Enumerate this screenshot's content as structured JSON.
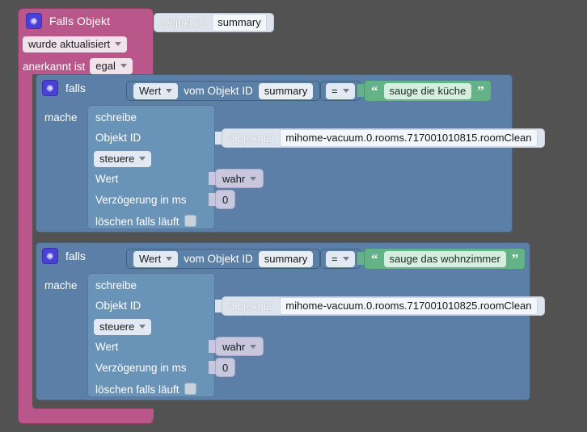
{
  "app": {
    "title": "Blockly script editor",
    "canvas_background": "#525252"
  },
  "colors": {
    "trigger_block": "#b9568a",
    "control_block": "#5b7fa6",
    "statement_block": "#6a93b8",
    "value_block": "#5b80a8",
    "string_block": "#64b287",
    "argument_block": "#dde4ed",
    "logic_block": "#c9c7de",
    "gear_icon": "#4a3fd6"
  },
  "trigger": {
    "gear_icon": "gear-icon",
    "title": "Falls Objekt",
    "object_id_label": "Objekt ID",
    "object_id_value": "summary",
    "condition_dropdown": "wurde aktualisiert",
    "ack_label": "anerkannt ist",
    "ack_dropdown": "egal"
  },
  "blocks": [
    {
      "gear_icon": "gear-icon",
      "if_label": "falls",
      "condition": {
        "value_dropdown": "Wert",
        "of_object_label": "vom Objekt ID",
        "object_id_value": "summary",
        "operator": "=",
        "compare_text": "sauge die küche",
        "quote_open": "“",
        "quote_close": "”"
      },
      "do_label": "mache",
      "statement": {
        "title": "schreibe",
        "object_id_label": "Objekt ID",
        "object_id_arg_label": "Objekt ID",
        "object_id_arg_value": "mihome-vacuum.0.rooms.717001010815.roomClean",
        "mode_dropdown": "steuere",
        "value_label": "Wert",
        "value_dropdown": "wahr",
        "delay_label": "Verzögerung in ms",
        "delay_value": "0",
        "clear_label": "löschen falls läuft",
        "clear_checked": false
      }
    },
    {
      "gear_icon": "gear-icon",
      "if_label": "falls",
      "condition": {
        "value_dropdown": "Wert",
        "of_object_label": "vom Objekt ID",
        "object_id_value": "summary",
        "operator": "=",
        "compare_text": "sauge das wohnzimmer",
        "quote_open": "“",
        "quote_close": "”"
      },
      "do_label": "mache",
      "statement": {
        "title": "schreibe",
        "object_id_label": "Objekt ID",
        "object_id_arg_label": "Objekt ID",
        "object_id_arg_value": "mihome-vacuum.0.rooms.717001010825.roomClean",
        "mode_dropdown": "steuere",
        "value_label": "Wert",
        "value_dropdown": "wahr",
        "delay_label": "Verzögerung in ms",
        "delay_value": "0",
        "clear_label": "löschen falls läuft",
        "clear_checked": false
      }
    }
  ]
}
